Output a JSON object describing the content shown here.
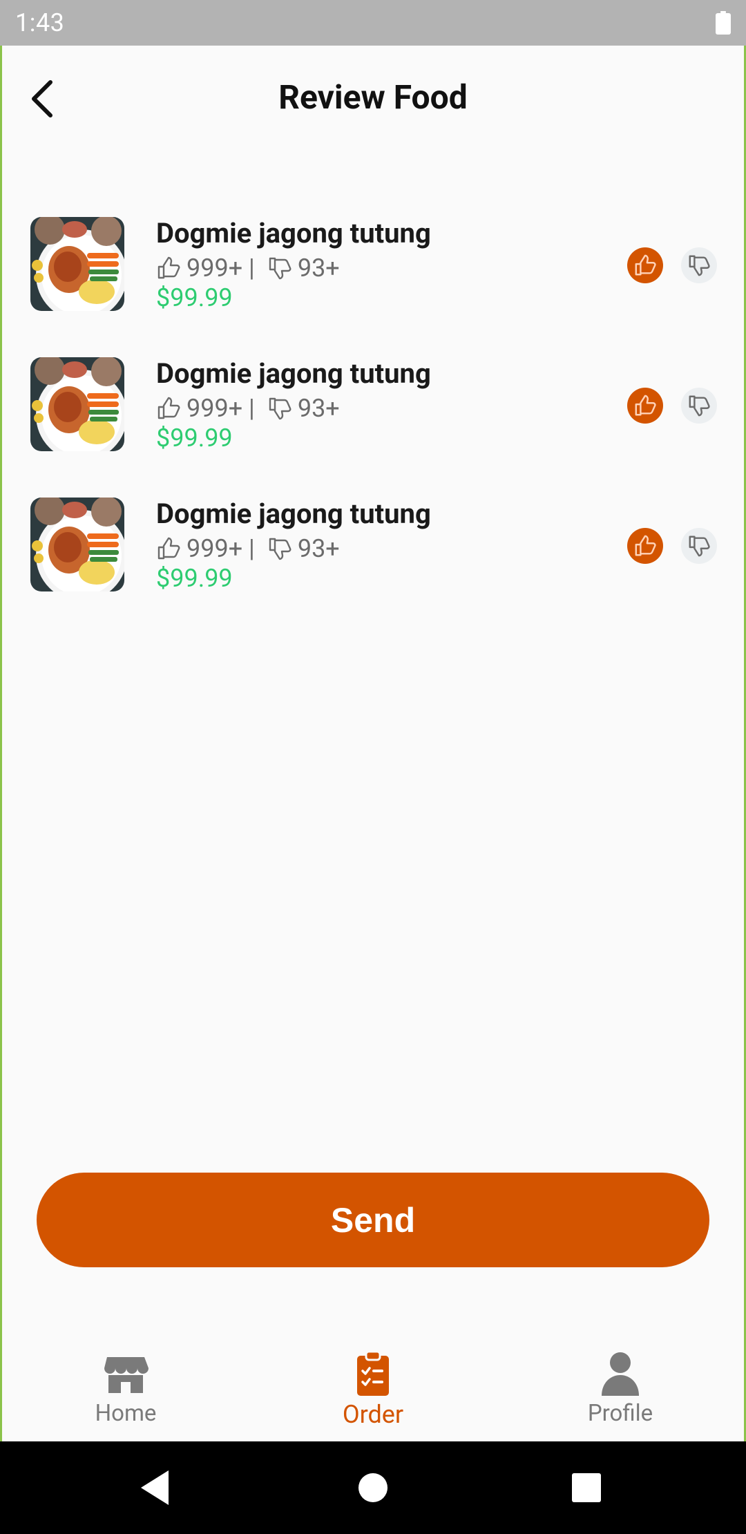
{
  "status_bar": {
    "time": "1:43",
    "battery_icon": "battery-full-icon"
  },
  "header": {
    "title": "Review Food",
    "back_icon": "chevron-left-icon"
  },
  "colors": {
    "accent": "#d35400",
    "price": "#2ecc71",
    "frame": "#8bc34a"
  },
  "food_items": [
    {
      "name": "Dogmie jagong tutung",
      "likes": "999+ |",
      "dislikes": "93+",
      "price": "$99.99",
      "selected": "like"
    },
    {
      "name": "Dogmie jagong tutung",
      "likes": "999+ |",
      "dislikes": "93+",
      "price": "$99.99",
      "selected": "like"
    },
    {
      "name": "Dogmie jagong tutung",
      "likes": "999+ |",
      "dislikes": "93+",
      "price": "$99.99",
      "selected": "like"
    }
  ],
  "send_button": {
    "label": "Send"
  },
  "bottom_nav": {
    "items": [
      {
        "label": "Home",
        "icon": "store-icon",
        "active": false
      },
      {
        "label": "Order",
        "icon": "clipboard-check-icon",
        "active": true
      },
      {
        "label": "Profile",
        "icon": "person-icon",
        "active": false
      }
    ]
  },
  "system_nav": {
    "back": "triangle-back-icon",
    "home": "circle-home-icon",
    "recents": "square-recents-icon"
  }
}
